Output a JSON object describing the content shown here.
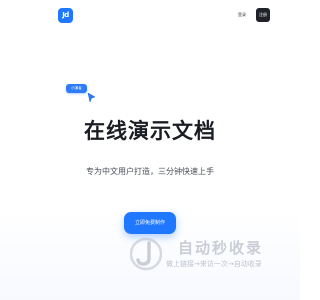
{
  "header": {
    "logo_text": "Jd",
    "nav": [
      "",
      "",
      "",
      "",
      ""
    ],
    "login_label": "登录",
    "register_label": "注册"
  },
  "hero": {
    "tag_label": "小演者",
    "title": "在线演示文档",
    "subtitle": "专为中文用户打造，三分钟快速上手",
    "cta_label": "立即免费制作"
  },
  "watermark": {
    "title": "自动秒收录",
    "subtitle": "做上链接→来访一次→自动收录"
  },
  "colors": {
    "accent": "#1f78ff",
    "title": "#1a1d24",
    "dark_button": "#1f2229"
  },
  "icons": {
    "cursor": "cursor-arrow-icon",
    "watermark": "watermark-j-icon"
  }
}
